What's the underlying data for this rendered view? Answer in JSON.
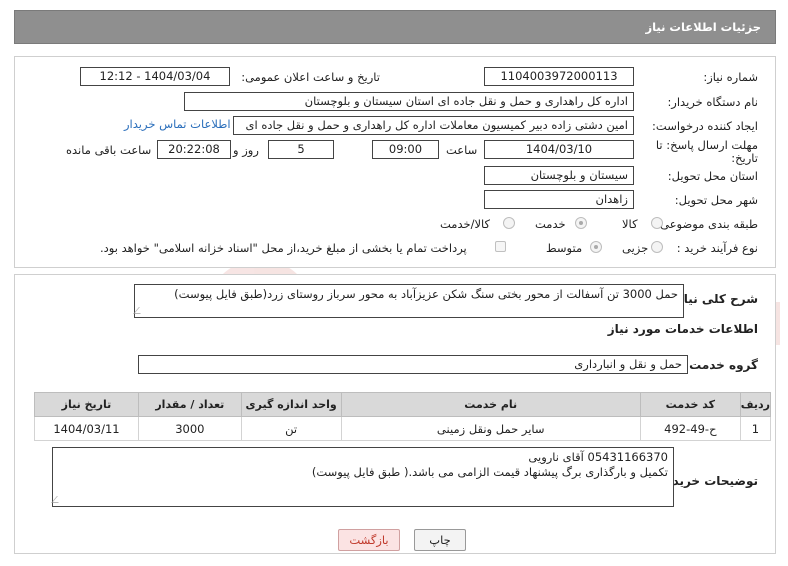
{
  "header": {
    "title": "جزئیات اطلاعات نیاز"
  },
  "form": {
    "need_number_label": "شماره نیاز:",
    "need_number": "1104003972000113",
    "announce_label": "تاریخ و ساعت اعلان عمومی:",
    "announce_value": "1404/03/04 - 12:12",
    "buyer_label": "نام دستگاه خریدار:",
    "buyer_value": "اداره کل راهداری و حمل و نقل جاده ای استان سیستان و بلوچستان",
    "creator_label": "ایجاد کننده درخواست:",
    "creator_value": "امین دشتی زاده دبیر کمیسیون معاملات اداره کل راهداری و حمل و نقل جاده ای",
    "contact_link": "اطلاعات تماس خریدار",
    "deadline_label_1": "مهلت ارسال پاسخ: تا",
    "deadline_label_2": "تاریخ:",
    "deadline_date": "1404/03/10",
    "time_label": "ساعت",
    "deadline_time": "09:00",
    "days_value": "5",
    "days_label": "روز و",
    "remaining_time": "20:22:08",
    "remaining_label": "ساعت باقی مانده",
    "province_label": "استان محل تحویل:",
    "province_value": "سیستان و بلوچستان",
    "city_label": "شهر محل تحویل:",
    "city_value": "زاهدان",
    "category_label": "طبقه بندی موضوعی:",
    "category_options": [
      "کالا",
      "خدمت",
      "کالا/خدمت"
    ],
    "process_label": "نوع فرآیند خرید :",
    "process_options": [
      "جزیی",
      "متوسط"
    ],
    "payment_note": "پرداخت تمام یا بخشی از مبلغ خرید،از محل \"اسناد خزانه اسلامی\" خواهد بود."
  },
  "description": {
    "label": "شرح کلی نیاز:",
    "value": "حمل 3000 تن آسفالت از محور بختی سنگ شکن عزیزآباد به محور سرباز روستای زرد(طبق فایل پیوست)"
  },
  "services": {
    "section_title": "اطلاعات خدمات مورد نیاز",
    "group_label": "گروه خدمت:",
    "group_value": "حمل و نقل و انبارداری",
    "columns": [
      "ردیف",
      "کد خدمت",
      "نام خدمت",
      "واحد اندازه گیری",
      "تعداد / مقدار",
      "تاریخ نیاز"
    ],
    "rows": [
      [
        "1",
        "ح-49-492",
        "سایر حمل ونقل زمینی",
        "تن",
        "3000",
        "1404/03/11"
      ]
    ]
  },
  "buyer_notes": {
    "label": "توضیحات خریدار:",
    "line1": "05431166370 آقای نارویی",
    "line2": "تکمیل و بارگذاری برگ پیشنهاد قیمت الزامی می باشد.( طبق فایل پیوست)"
  },
  "buttons": {
    "print": "چاپ",
    "back": "بازگشت"
  },
  "watermark": {
    "text": "AriaTender.neT"
  },
  "colors": {
    "header_bg": "#8f8f8f",
    "link": "#2a6ebb",
    "back_text": "#c0392b"
  }
}
